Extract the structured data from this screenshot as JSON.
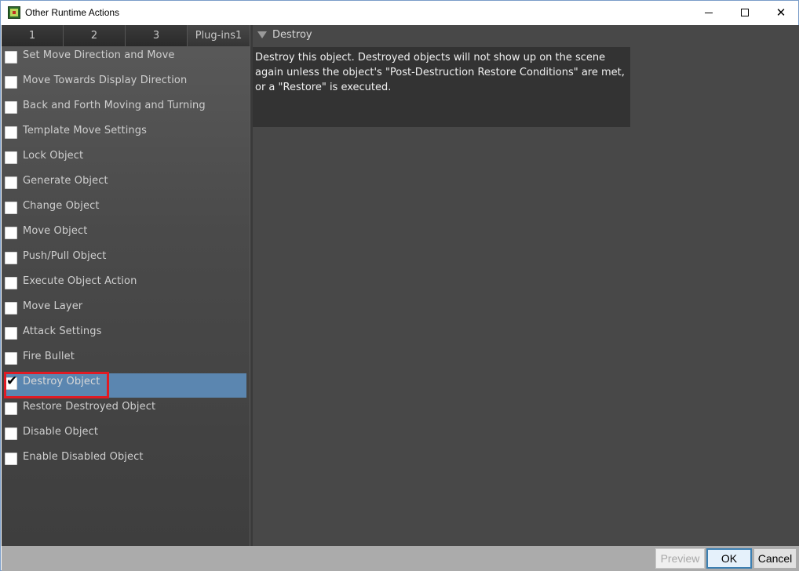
{
  "window": {
    "title": "Other Runtime Actions",
    "controls": {
      "minimize": "minimize",
      "maximize": "maximize",
      "close": "✕"
    }
  },
  "tabs": [
    {
      "label": "1"
    },
    {
      "label": "2"
    },
    {
      "label": "3"
    },
    {
      "label": "Plug-ins1"
    }
  ],
  "actions": [
    {
      "label": "Set Move Direction and Move",
      "checked": false
    },
    {
      "label": "Move Towards Display Direction",
      "checked": false
    },
    {
      "label": "Back and Forth Moving and Turning",
      "checked": false
    },
    {
      "label": "Template Move Settings",
      "checked": false
    },
    {
      "label": "Lock Object",
      "checked": false
    },
    {
      "label": "Generate Object",
      "checked": false
    },
    {
      "label": "Change Object",
      "checked": false
    },
    {
      "label": "Move Object",
      "checked": false
    },
    {
      "label": "Push/Pull Object",
      "checked": false
    },
    {
      "label": "Execute Object Action",
      "checked": false
    },
    {
      "label": "Move Layer",
      "checked": false
    },
    {
      "label": "Attack Settings",
      "checked": false
    },
    {
      "label": "Fire Bullet",
      "checked": false
    },
    {
      "label": "Destroy Object",
      "checked": true,
      "selected": true
    },
    {
      "label": "Restore Destroyed Object",
      "checked": false
    },
    {
      "label": "Disable Object",
      "checked": false
    },
    {
      "label": "Enable Disabled Object",
      "checked": false
    }
  ],
  "detail": {
    "section_title": "Destroy",
    "description_lines": [
      "Destroy this object. Destroyed objects will not show up on the scene",
      "again unless the object's \"Post-Destruction Restore Conditions\" are met,",
      "or a \"Restore\" is executed."
    ]
  },
  "buttons": {
    "preview": "Preview",
    "ok": "OK",
    "cancel": "Cancel"
  },
  "colors": {
    "selection": "#5b86b0",
    "highlight_border": "#e01b24",
    "ok_border": "#3c7fb1"
  }
}
